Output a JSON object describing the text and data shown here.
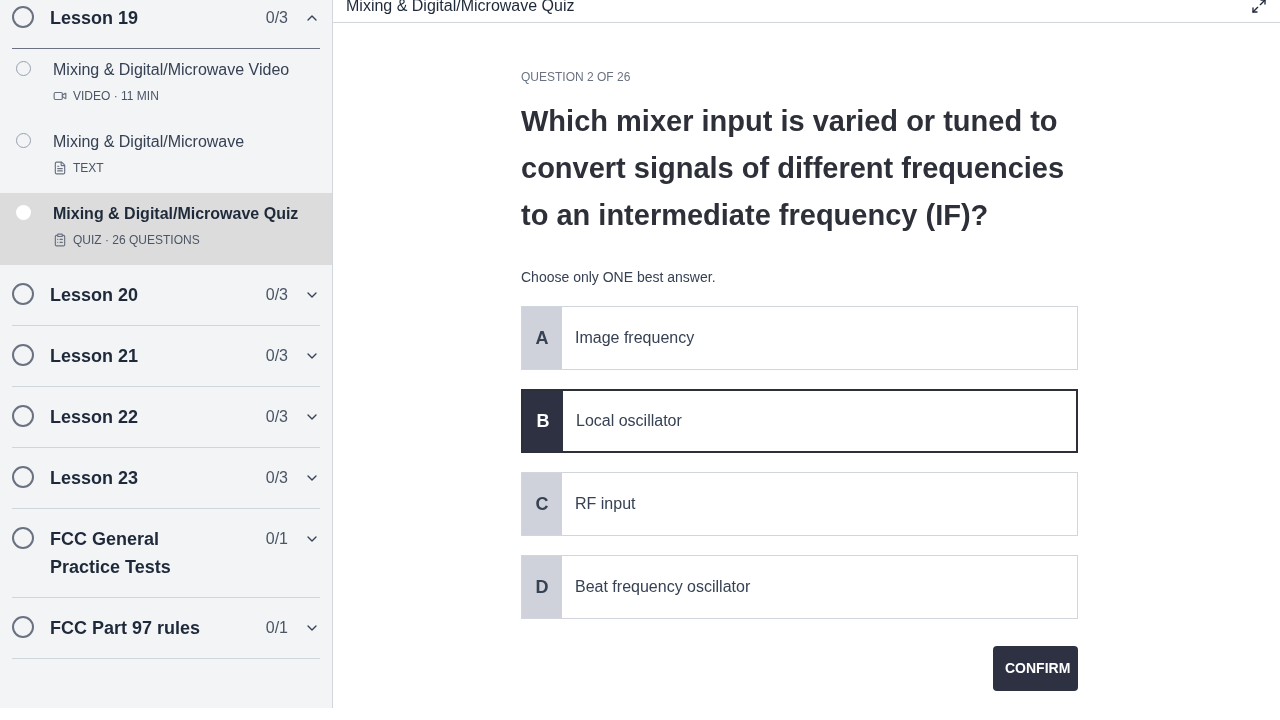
{
  "sidebar": {
    "lessons": [
      {
        "title": "Lesson 19",
        "progress": "0/3",
        "expanded": true,
        "items": [
          {
            "kind": "video",
            "title": "Mixing & Digital/Microwave Video",
            "meta": "VIDEO · 11 MIN",
            "selected": false
          },
          {
            "kind": "text",
            "title": "Mixing & Digital/Microwave",
            "meta": "TEXT",
            "selected": false
          },
          {
            "kind": "quiz",
            "title": "Mixing & Digital/Microwave Quiz",
            "meta": "QUIZ · 26 QUESTIONS",
            "selected": true
          }
        ]
      },
      {
        "title": "Lesson 20",
        "progress": "0/3",
        "expanded": false
      },
      {
        "title": "Lesson 21",
        "progress": "0/3",
        "expanded": false
      },
      {
        "title": "Lesson 22",
        "progress": "0/3",
        "expanded": false
      },
      {
        "title": "Lesson 23",
        "progress": "0/3",
        "expanded": false
      },
      {
        "title": "FCC General Practice Tests",
        "progress": "0/1",
        "expanded": false
      },
      {
        "title": "FCC Part 97 rules",
        "progress": "0/1",
        "expanded": false
      }
    ]
  },
  "header": {
    "title": "Mixing & Digital/Microwave Quiz"
  },
  "quiz": {
    "counter": "QUESTION 2 OF 26",
    "question": "Which mixer input is varied or tuned to convert signals of different frequencies to an intermediate frequency (IF)?",
    "instruction": "Choose only ONE best answer.",
    "options": [
      {
        "letter": "A",
        "text": "Image frequency",
        "selected": false
      },
      {
        "letter": "B",
        "text": "Local oscillator",
        "selected": true
      },
      {
        "letter": "C",
        "text": "RF input",
        "selected": false
      },
      {
        "letter": "D",
        "text": "Beat frequency oscillator",
        "selected": false
      }
    ],
    "confirm": "CONFIRM"
  }
}
